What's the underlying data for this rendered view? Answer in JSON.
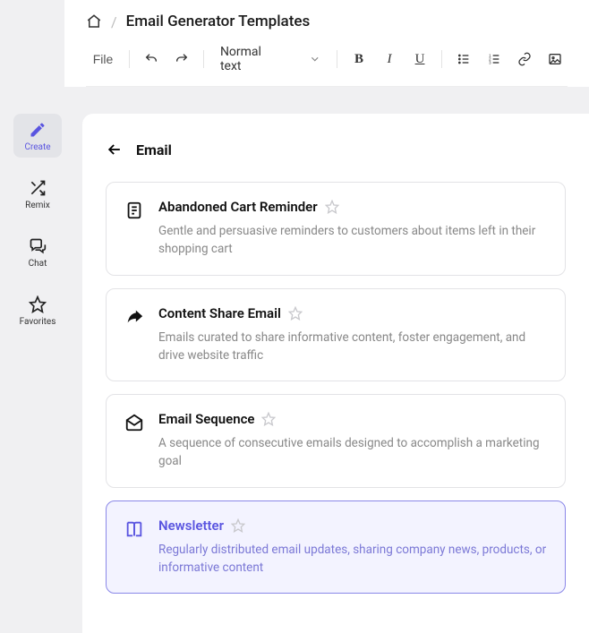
{
  "breadcrumb": {
    "title": "Email Generator Templates"
  },
  "toolbar": {
    "file_label": "File",
    "format_label": "Normal text"
  },
  "sidebar": {
    "items": [
      {
        "label": "Create"
      },
      {
        "label": "Remix"
      },
      {
        "label": "Chat"
      },
      {
        "label": "Favorites"
      }
    ]
  },
  "content": {
    "title": "Email",
    "templates": [
      {
        "title": "Abandoned Cart Reminder",
        "desc": "Gentle and persuasive reminders to customers about items left in their shopping cart"
      },
      {
        "title": "Content Share Email",
        "desc": "Emails curated to share informative content, foster engagement, and drive website traffic"
      },
      {
        "title": "Email Sequence",
        "desc": "A sequence of consecutive emails designed to accomplish a marketing goal"
      },
      {
        "title": "Newsletter",
        "desc": "Regularly distributed email updates, sharing company news, products, or informative content"
      }
    ]
  }
}
